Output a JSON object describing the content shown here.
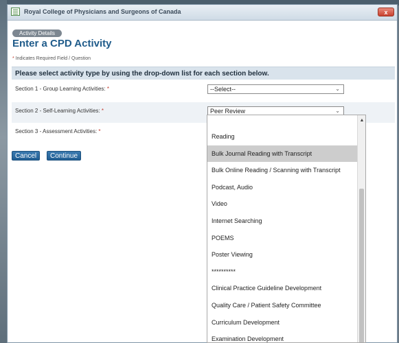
{
  "window": {
    "title": "Royal College of Physicians and Surgeons of Canada",
    "close_label": "x"
  },
  "page": {
    "tag": "Activity Details",
    "heading": "Enter a CPD Activity",
    "required_star": "*",
    "required_note": "Indicates Required Field / Question",
    "instruction": "Please select activity type by using the drop-down list for each section below."
  },
  "sections": [
    {
      "label": "Section 1 - Group Learning Activities:",
      "star": "*",
      "value": "--Select--"
    },
    {
      "label": "Section 2 - Self-Learning Activities:",
      "star": "*",
      "value": "Peer Review"
    },
    {
      "label": "Section 3 - Assessment Activities:",
      "star": "*",
      "value": ""
    }
  ],
  "buttons": {
    "cancel": "Cancel",
    "continue": "Continue"
  },
  "dropdown": {
    "top_separator": "**********",
    "highlighted_index": 2,
    "items": [
      "Reading",
      "Bulk Journal Reading with Transcript",
      "Bulk Online Reading / Scanning with Transcript",
      "Podcast, Audio",
      "Video",
      "Internet Searching",
      "POEMS",
      "Poster Viewing",
      "**********",
      "Clinical Practice Guideline Development",
      "Quality Care / Patient Safety Committee",
      "Curriculum Development",
      "Examination Development"
    ]
  }
}
